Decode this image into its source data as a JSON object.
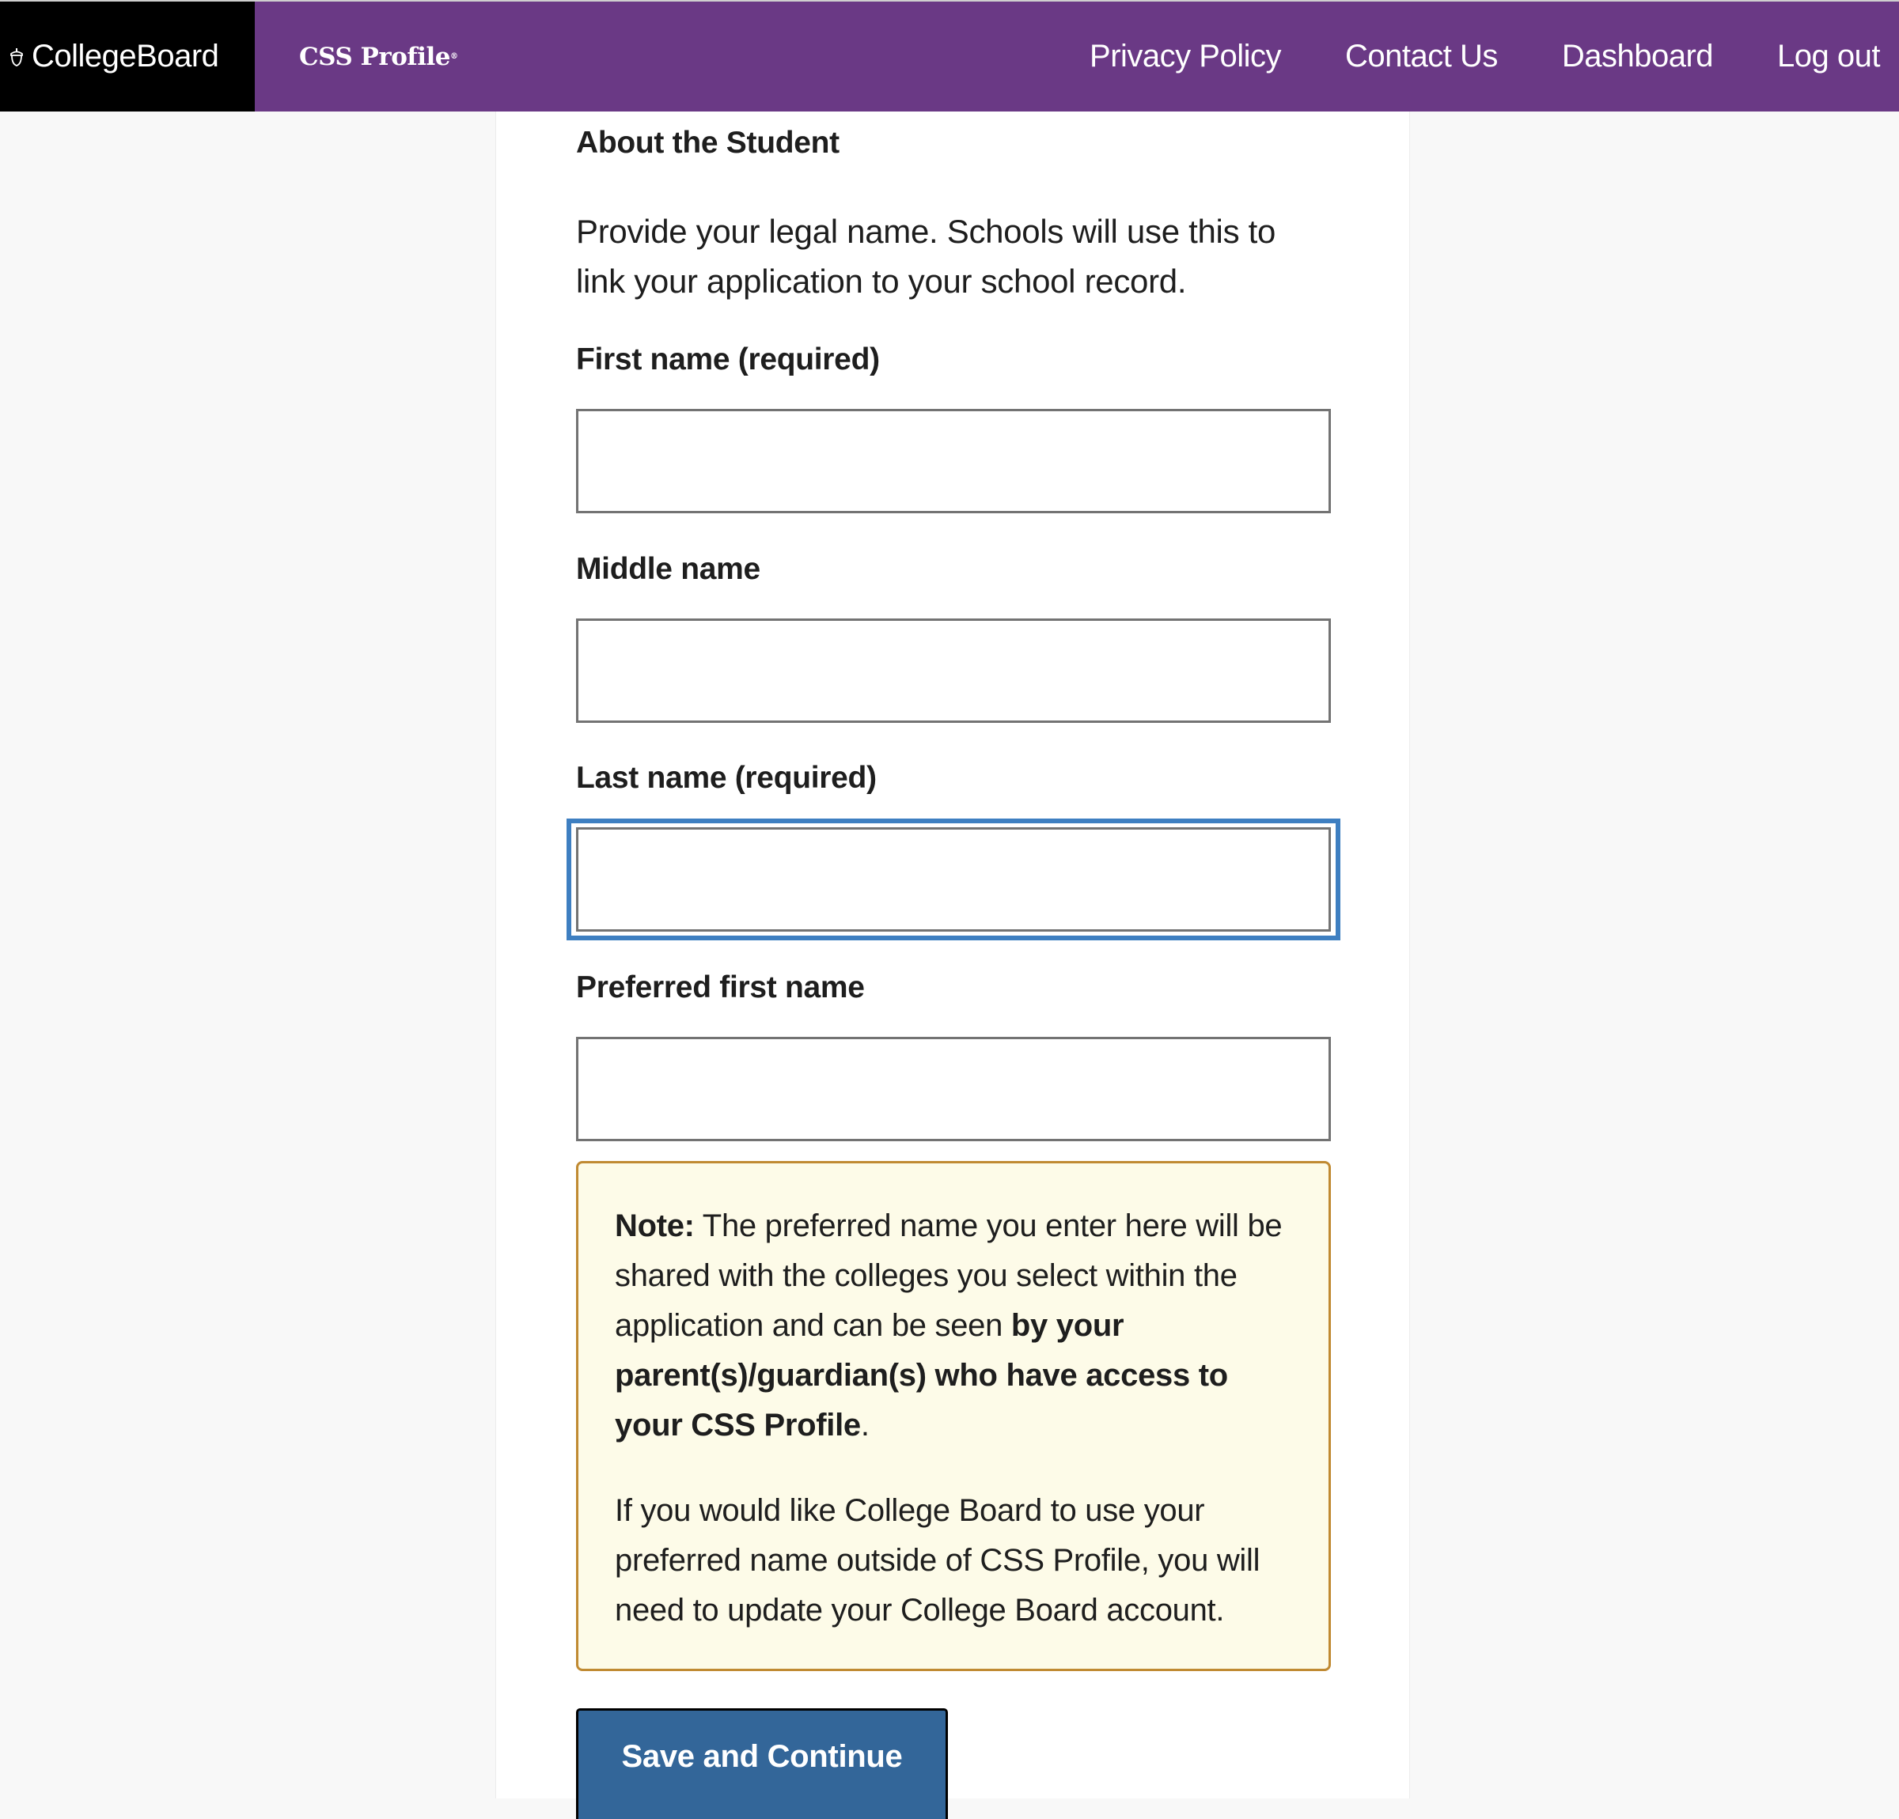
{
  "header": {
    "brand": "CollegeBoard",
    "product": "CSS Profile",
    "product_mark": "®",
    "nav": [
      {
        "label": "Privacy Policy"
      },
      {
        "label": "Contact Us"
      },
      {
        "label": "Dashboard"
      },
      {
        "label": "Log out"
      }
    ],
    "colors": {
      "nav_bg": "#6a3985",
      "logo_bg": "#000000"
    }
  },
  "form": {
    "section_title": "About the Student",
    "intro": "Provide your legal name. Schools will use this to link your application to your school record.",
    "fields": [
      {
        "label": "First name (required)",
        "value": "",
        "focused": false
      },
      {
        "label": "Middle name",
        "value": "",
        "focused": false
      },
      {
        "label": "Last name (required)",
        "value": "",
        "focused": true
      },
      {
        "label": "Preferred first name",
        "value": "",
        "focused": false
      }
    ],
    "note": {
      "prefix": "Note:",
      "p1_part1": " The preferred name you enter here will be shared with the colleges you select within the application and can be seen ",
      "p1_bold": "by your parent(s)/guardian(s) who have access to your CSS Profile",
      "p1_end": ".",
      "p2": "If you would like College Board to use your preferred name outside of CSS Profile, you will need to update your College Board account."
    },
    "submit_label": "Save and Continue",
    "colors": {
      "focus_ring": "#3e7fc1",
      "note_border": "#c08a32",
      "note_bg": "#fdfbe8",
      "button_bg": "#336699"
    }
  }
}
